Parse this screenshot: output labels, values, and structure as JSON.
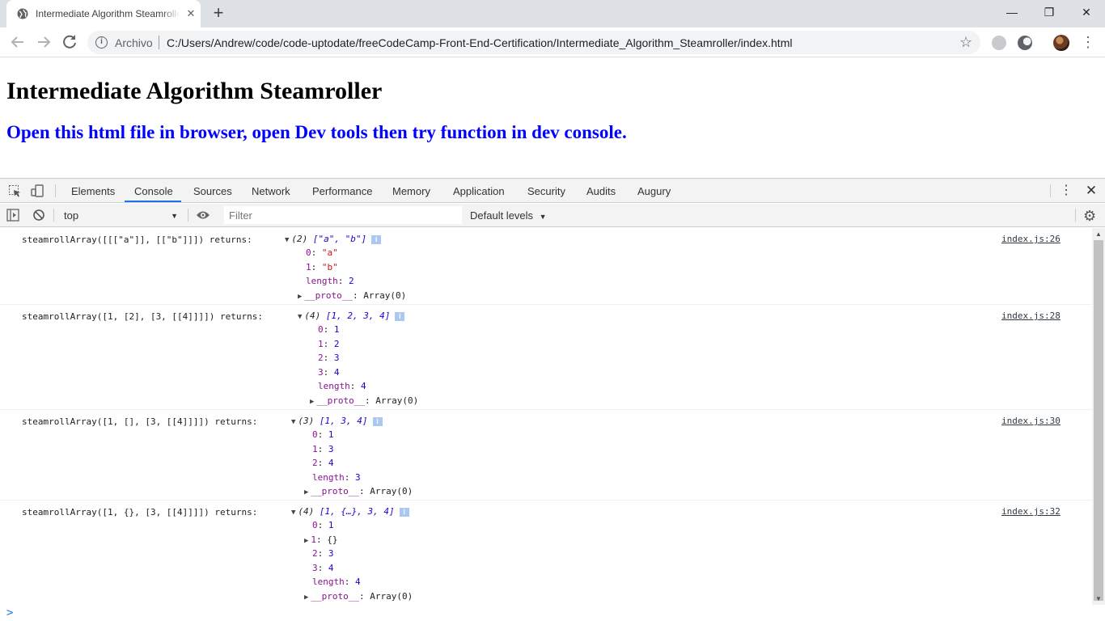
{
  "browser": {
    "tab_title": "Intermediate Algorithm Steamroller",
    "tab_close": "✕",
    "new_tab": "+",
    "window": {
      "minimize": "—",
      "restore": "❐",
      "close": "✕"
    },
    "omnibox_label": "Archivo",
    "url": "C:/Users/Andrew/code/code-uptodate/freeCodeCamp-Front-End-Certification/Intermediate_Algorithm_Steamroller/index.html"
  },
  "page": {
    "heading": "Intermediate Algorithm Steamroller",
    "subheading": "Open this html file in browser, open Dev tools then try function in dev console."
  },
  "devtools": {
    "tabs": [
      "Elements",
      "Console",
      "Sources",
      "Network",
      "Performance",
      "Memory",
      "Application",
      "Security",
      "Audits",
      "Augury"
    ],
    "active_tab": "Console",
    "context": "top",
    "filter_placeholder": "Filter",
    "levels": "Default levels",
    "messages": [
      {
        "command": "steamrollArray([[[\"a\"]], [[\"b\"]]]) returns:",
        "source": "index.js:26",
        "count": "(2)",
        "summary": "[\"a\", \"b\"]",
        "props": [
          {
            "key": "0",
            "value": "\"a\"",
            "type": "str"
          },
          {
            "key": "1",
            "value": "\"b\"",
            "type": "str"
          },
          {
            "key": "length",
            "value": "2",
            "type": "num"
          }
        ],
        "proto": "Array(0)"
      },
      {
        "command": "steamrollArray([1, [2], [3, [[4]]]]) returns:",
        "source": "index.js:28",
        "count": "(4)",
        "summary": "[1, 2, 3, 4]",
        "props": [
          {
            "key": "0",
            "value": "1",
            "type": "num"
          },
          {
            "key": "1",
            "value": "2",
            "type": "num"
          },
          {
            "key": "2",
            "value": "3",
            "type": "num"
          },
          {
            "key": "3",
            "value": "4",
            "type": "num"
          },
          {
            "key": "length",
            "value": "4",
            "type": "num"
          }
        ],
        "proto": "Array(0)"
      },
      {
        "command": "steamrollArray([1, [], [3, [[4]]]]) returns:",
        "source": "index.js:30",
        "count": "(3)",
        "summary": "[1, 3, 4]",
        "props": [
          {
            "key": "0",
            "value": "1",
            "type": "num"
          },
          {
            "key": "1",
            "value": "3",
            "type": "num"
          },
          {
            "key": "2",
            "value": "4",
            "type": "num"
          },
          {
            "key": "length",
            "value": "3",
            "type": "num"
          }
        ],
        "proto": "Array(0)"
      },
      {
        "command": "steamrollArray([1, {}, [3, [[4]]]]) returns:",
        "source": "index.js:32",
        "count": "(4)",
        "summary": "[1, {…}, 3, 4]",
        "props": [
          {
            "key": "0",
            "value": "1",
            "type": "num"
          },
          {
            "key": "1",
            "value": "{}",
            "type": "obj"
          },
          {
            "key": "2",
            "value": "3",
            "type": "num"
          },
          {
            "key": "3",
            "value": "4",
            "type": "num"
          },
          {
            "key": "length",
            "value": "4",
            "type": "num"
          }
        ],
        "proto": "Array(0)"
      }
    ],
    "proto_key": "__proto__",
    "prompt": ">"
  }
}
